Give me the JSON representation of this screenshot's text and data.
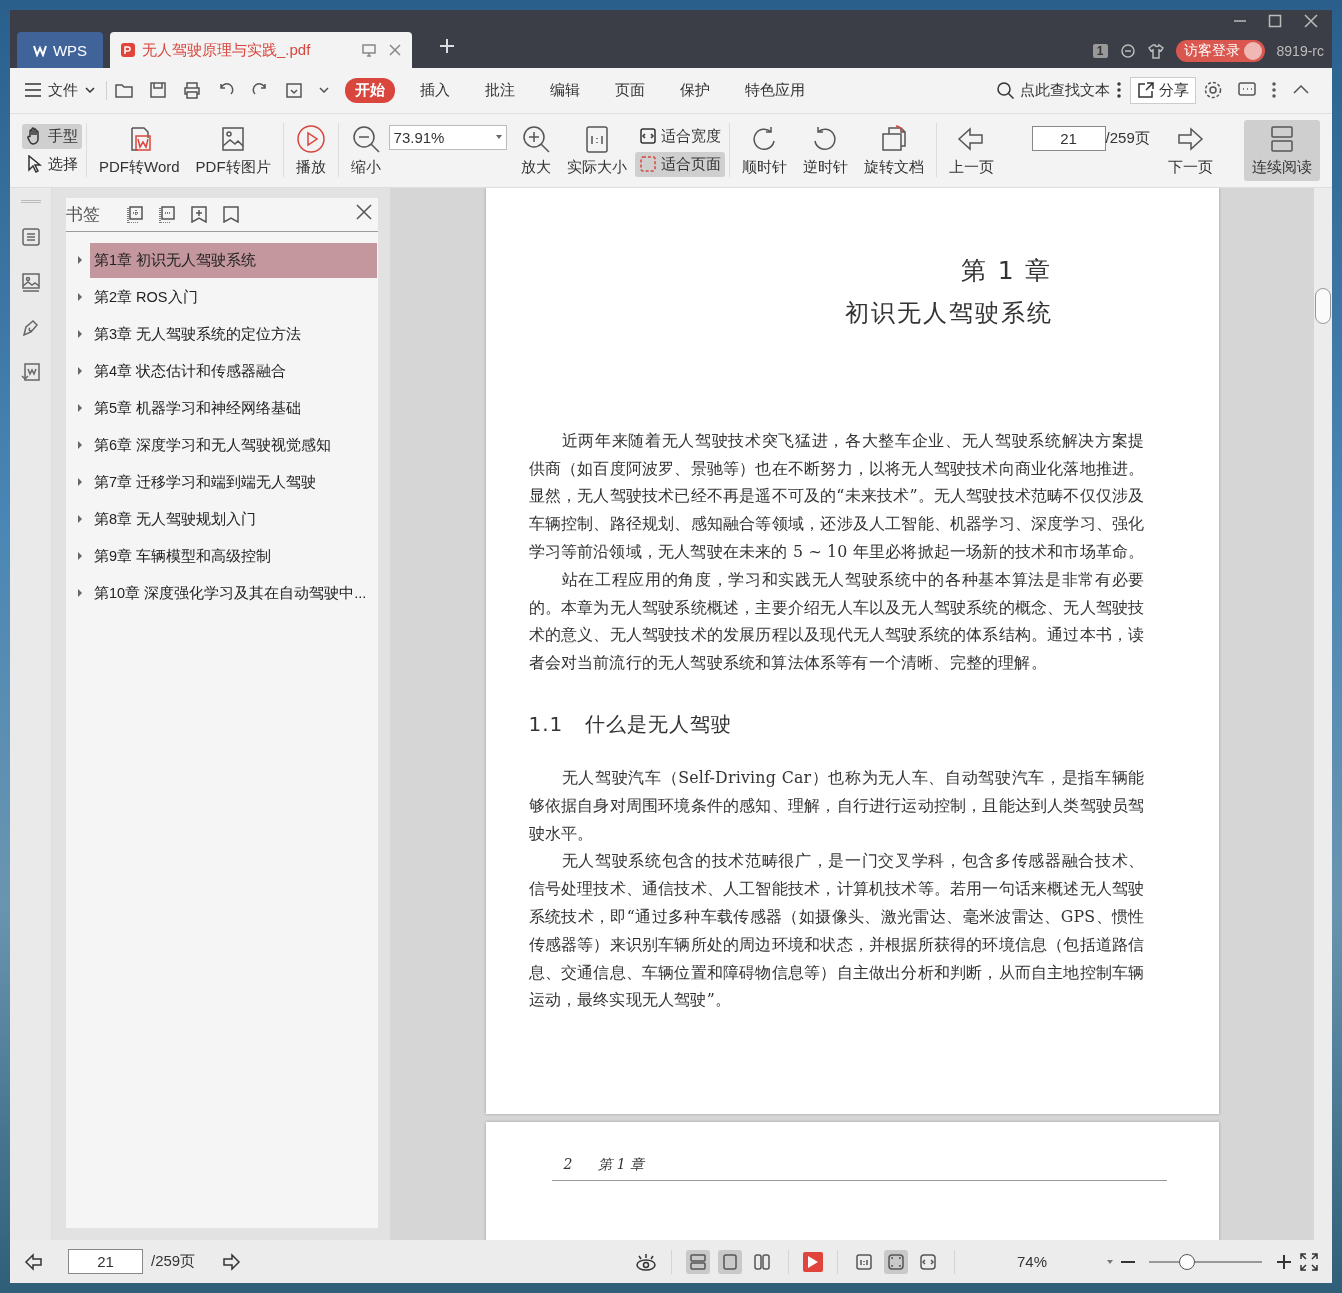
{
  "tabs": [
    {
      "label": "WPS",
      "selected": false,
      "kind": "home"
    },
    {
      "label": "无人驾驶原理与实践_.pdf",
      "selected": true,
      "kind": "document"
    }
  ],
  "title_bar": {
    "window_count": "1",
    "login_button": "访客登录",
    "user_label": "8919-rc"
  },
  "menu": {
    "file": "文件",
    "tabs": [
      {
        "label": "开始",
        "selected": true
      },
      {
        "label": "插入",
        "selected": false
      },
      {
        "label": "批注",
        "selected": false
      },
      {
        "label": "编辑",
        "selected": false
      },
      {
        "label": "页面",
        "selected": false
      },
      {
        "label": "保护",
        "selected": false
      },
      {
        "label": "特色应用",
        "selected": false
      }
    ],
    "search_placeholder": "点此查找文本",
    "share": "分享"
  },
  "toolbar": {
    "modes": [
      {
        "label": "手型",
        "selected": true
      },
      {
        "label": "选择",
        "selected": false
      }
    ],
    "convert": [
      "PDF转Word",
      "PDF转图片"
    ],
    "play": "播放",
    "zoom_out": "缩小",
    "zoom": "73.91%",
    "zoom_in": "放大",
    "actual_size": "实际大小",
    "fit": [
      {
        "label": "适合宽度",
        "selected": false
      },
      {
        "label": "适合页面",
        "selected": true
      }
    ],
    "rotate": [
      "顺时针",
      "逆时针",
      "旋转文档"
    ],
    "prev_page": "上一页",
    "page": "21",
    "page_total": "/259页",
    "next_page": "下一页",
    "continuous": {
      "label": "连续阅读",
      "selected": true
    }
  },
  "sidebar": {
    "title": "书签",
    "bookmarks": [
      {
        "label": "第1章 初识无人驾驶系统",
        "selected": true,
        "expanded": false
      },
      {
        "label": "第2章 ROS入门",
        "selected": false,
        "expanded": false
      },
      {
        "label": "第3章 无人驾驶系统的定位方法",
        "selected": false,
        "expanded": false
      },
      {
        "label": "第4章 状态估计和传感器融合",
        "selected": false,
        "expanded": false
      },
      {
        "label": "第5章 机器学习和神经网络基础",
        "selected": false,
        "expanded": false
      },
      {
        "label": "第6章 深度学习和无人驾驶视觉感知",
        "selected": false,
        "expanded": false
      },
      {
        "label": "第7章 迁移学习和端到端无人驾驶",
        "selected": false,
        "expanded": false
      },
      {
        "label": "第8章 无人驾驶规划入门",
        "selected": false,
        "expanded": false
      },
      {
        "label": "第9章 车辆模型和高级控制",
        "selected": false,
        "expanded": false
      },
      {
        "label": "第10章 深度强化学习及其在自动驾驶中...",
        "selected": false,
        "expanded": false
      }
    ]
  },
  "document": {
    "chapter_number": "第 1 章",
    "chapter_title": "初识无人驾驶系统",
    "blocks": [
      {
        "kind": "paragraph",
        "text": "近两年来随着无人驾驶技术突飞猛进，各大整车企业、无人驾驶系统解决方案提供商（如百度阿波罗、景驰等）也在不断努力，以将无人驾驶技术向商业化落地推进。显然，无人驾驶技术已经不再是遥不可及的“未来技术”。无人驾驶技术范畴不仅仅涉及车辆控制、路径规划、感知融合等领域，还涉及人工智能、机器学习、深度学习、强化学习等前沿领域，无人驾驶在未来的 5 ~ 10 年里必将掀起一场新的技术和市场革命。"
      },
      {
        "kind": "paragraph",
        "text": "站在工程应用的角度，学习和实践无人驾驶系统中的各种基本算法是非常有必要的。本章为无人驾驶系统概述，主要介绍无人车以及无人驾驶系统的概念、无人驾驶技术的意义、无人驾驶技术的发展历程以及现代无人驾驶系统的体系结构。通过本书，读者会对当前流行的无人驾驶系统和算法体系等有一个清晰、完整的理解。"
      },
      {
        "kind": "heading",
        "number": "1.1",
        "text": "什么是无人驾驶"
      },
      {
        "kind": "paragraph",
        "text": "无人驾驶汽车（Self-Driving Car）也称为无人车、自动驾驶汽车，是指车辆能够依据自身对周围环境条件的感知、理解，自行进行运动控制，且能达到人类驾驶员驾驶水平。"
      },
      {
        "kind": "paragraph",
        "text": "无人驾驶系统包含的技术范畴很广，是一门交叉学科，包含多传感器融合技术、信号处理技术、通信技术、人工智能技术，计算机技术等。若用一句话来概述无人驾驶系统技术，即“通过多种车载传感器（如摄像头、激光雷达、毫米波雷达、GPS、惯性传感器等）来识别车辆所处的周边环境和状态，并根据所获得的环境信息（包括道路信息、交通信息、车辆位置和障碍物信息等）自主做出分析和判断，从而自主地控制车辆运动，最终实现无人驾驶”。"
      }
    ],
    "next_page_header": {
      "page_number": "2",
      "chapter": "第 1 章"
    }
  },
  "status_bar": {
    "page": "21",
    "page_total": "/259页",
    "view_modes": [
      {
        "selected": true
      },
      {
        "selected": true
      },
      {
        "selected": false
      }
    ],
    "fit_modes": [
      {
        "selected": false
      },
      {
        "selected": true
      },
      {
        "selected": false
      }
    ],
    "zoom": "74%",
    "zoom_slider": {
      "level": 0.34
    }
  }
}
